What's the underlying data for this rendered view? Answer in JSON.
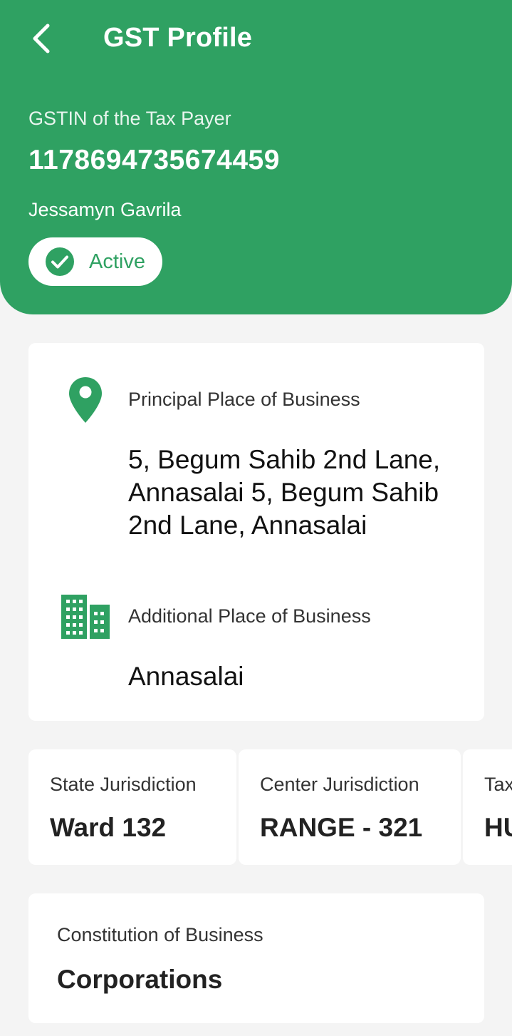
{
  "header": {
    "title": "GST Profile",
    "gstin_label": "GSTIN of the Tax Payer",
    "gstin_value": "1178694735674459",
    "taxpayer_name": "Jessamyn Gavrila",
    "status": "Active"
  },
  "business_places": {
    "principal_label": "Principal Place of Business",
    "principal_address": "5, Begum Sahib 2nd Lane, Annasalai 5, Begum Sahib 2nd Lane, Annasalai",
    "additional_label": "Additional Place of Business",
    "additional_address": "Annasalai"
  },
  "jurisdictions": [
    {
      "label": "State Jurisdiction",
      "value": "Ward 132"
    },
    {
      "label": "Center Jurisdiction",
      "value": "RANGE - 321"
    },
    {
      "label": "Tax",
      "value": "HU"
    }
  ],
  "constitution": {
    "label": "Constitution of Business",
    "value": "Corporations"
  },
  "colors": {
    "brand_green": "#2fa162",
    "background": "#f4f4f4",
    "card": "#ffffff"
  },
  "icons": {
    "back": "chevron-left-icon",
    "status": "check-circle-icon",
    "principal": "location-pin-icon",
    "additional": "building-icon"
  }
}
